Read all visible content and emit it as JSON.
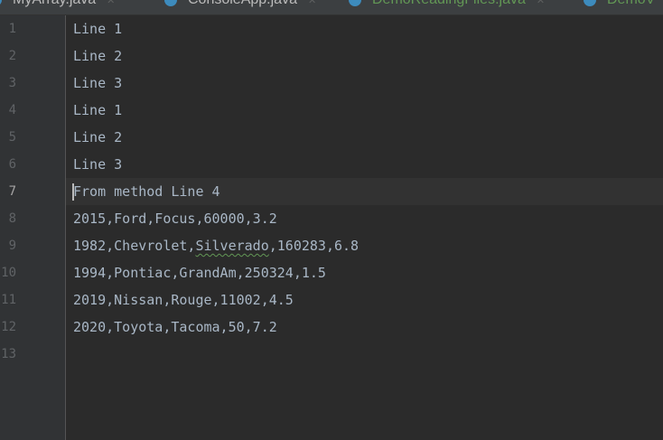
{
  "tabs": [
    {
      "label": "MyArray.java",
      "modified": false
    },
    {
      "label": "ConsoleApp.java",
      "modified": false
    },
    {
      "label": "DemoReadingFiles.java",
      "modified": true
    },
    {
      "label": "DemoV",
      "modified": true
    }
  ],
  "current_line": 7,
  "lines": [
    {
      "n": "1",
      "text": "Line 1"
    },
    {
      "n": "2",
      "text": "Line 2"
    },
    {
      "n": "3",
      "text": "Line 3"
    },
    {
      "n": "4",
      "text": "Line 1"
    },
    {
      "n": "5",
      "text": "Line 2"
    },
    {
      "n": "6",
      "text": "Line 3"
    },
    {
      "n": "7",
      "text": "From method Line 4"
    },
    {
      "n": "8",
      "text": "2015,Ford,Focus,60000,3.2"
    },
    {
      "n": "9",
      "pre": "1982,Chevrolet,",
      "squiggle": "Silverado",
      "post": ",160283,6.8"
    },
    {
      "n": "10",
      "text": "1994,Pontiac,GrandAm,250324,1.5"
    },
    {
      "n": "11",
      "text": "2019,Nissan,Rouge,11002,4.5"
    },
    {
      "n": "12",
      "text": "2020,Toyota,Tacoma,50,7.2"
    },
    {
      "n": "13",
      "text": ""
    }
  ]
}
